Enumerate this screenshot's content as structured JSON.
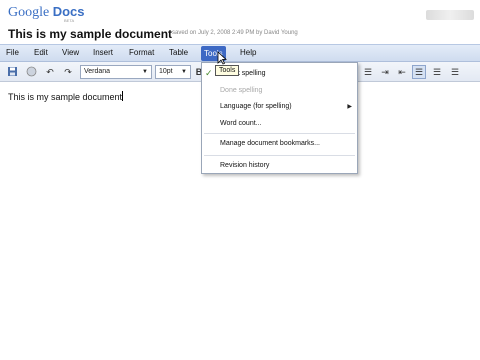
{
  "header": {
    "logo_google": "Google",
    "logo_docs": "Docs",
    "logo_sub": "BETA",
    "doc_title": "This is my sample document",
    "saved_info": "saved on July 2, 2008 2:49 PM by David Young"
  },
  "menubar": {
    "items": [
      "File",
      "Edit",
      "View",
      "Insert",
      "Format",
      "Table",
      "Tools",
      "Help"
    ],
    "active": "Tools"
  },
  "toolbar": {
    "undo_icon": "undo-icon",
    "redo_icon": "redo-icon",
    "font_name": "Verdana",
    "font_size": "10pt"
  },
  "tools_menu": {
    "tooltip": "Tools",
    "items": {
      "check_spelling": "Check spelling",
      "done_spelling": "Done spelling",
      "language": "Language (for spelling)",
      "word_count": "Word count...",
      "manage_bookmarks": "Manage document bookmarks...",
      "revision_history": "Revision history"
    }
  },
  "document": {
    "body_text": "This is my sample document"
  },
  "colors": {
    "menubar": "#cfdcef",
    "active_menu": "#3d69c4",
    "logo": "#3a6fc4"
  }
}
